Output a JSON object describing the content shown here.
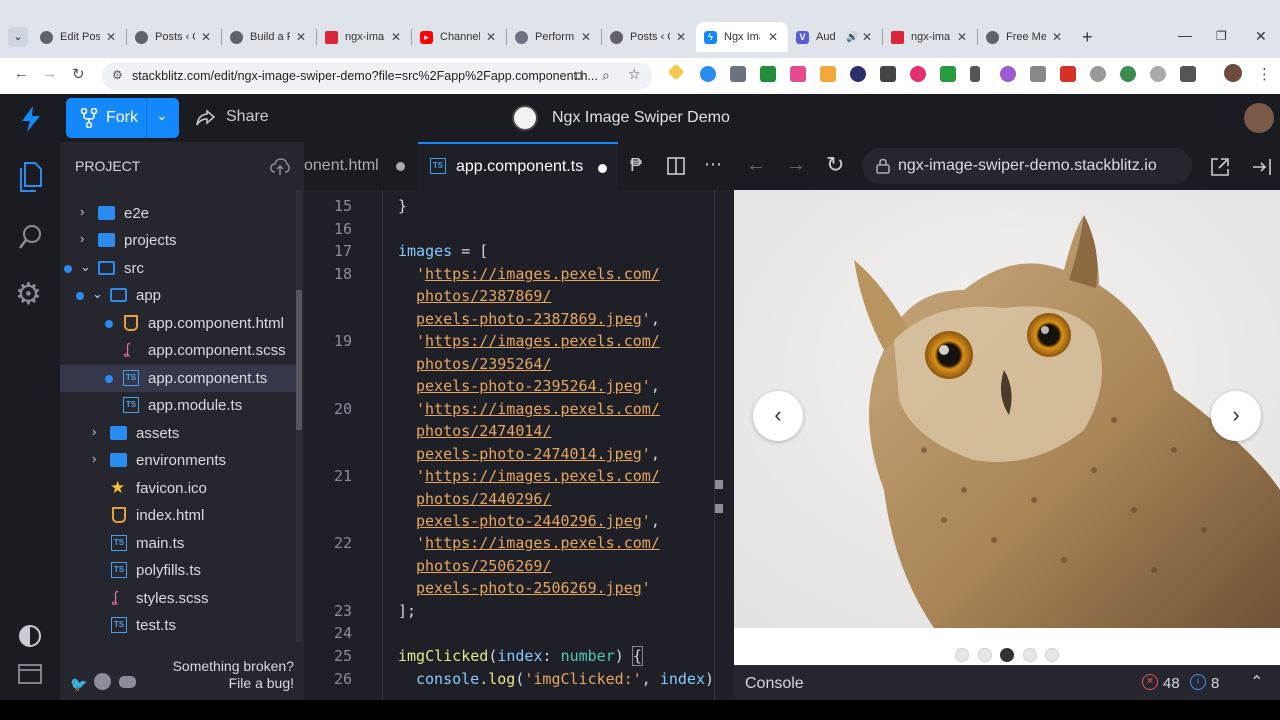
{
  "browser": {
    "tabs": [
      {
        "title": "Edit Post",
        "favicon_color": "#5f6368"
      },
      {
        "title": "Posts ‹ C",
        "favicon_color": "#5f6368"
      },
      {
        "title": "Build a F",
        "favicon_color": "#5f6368"
      },
      {
        "title": "ngx-ima",
        "favicon_color": "#d9263a"
      },
      {
        "title": "Channel",
        "favicon_color": "#ff0000"
      },
      {
        "title": "Perform",
        "favicon_color": "#6b7280"
      },
      {
        "title": "Posts ‹ C",
        "favicon_color": "#5f6368"
      },
      {
        "title": "Ngx Ima",
        "favicon_color": "#1389fd",
        "active": true
      },
      {
        "title": "Aud",
        "favicon_color": "#5b5bd6"
      },
      {
        "title": "ngx-ima",
        "favicon_color": "#d9263a"
      },
      {
        "title": "Free Me",
        "favicon_color": "#5f6368"
      }
    ],
    "url": "stackblitz.com/edit/ngx-image-swiper-demo?file=src%2Fapp%2Fapp.component.h..."
  },
  "header": {
    "fork_label": "Fork",
    "share_label": "Share",
    "project_title": "Ngx Image Swiper Demo"
  },
  "explorer": {
    "title": "PROJECT",
    "items": [
      {
        "name": "e2e",
        "type": "folder"
      },
      {
        "name": "projects",
        "type": "folder"
      },
      {
        "name": "src",
        "type": "folder-open"
      },
      {
        "name": "app",
        "type": "folder-open"
      },
      {
        "name": "app.component.html",
        "type": "html"
      },
      {
        "name": "app.component.scss",
        "type": "scss"
      },
      {
        "name": "app.component.ts",
        "type": "ts",
        "selected": true
      },
      {
        "name": "app.module.ts",
        "type": "ts"
      },
      {
        "name": "assets",
        "type": "folder"
      },
      {
        "name": "environments",
        "type": "folder"
      },
      {
        "name": "favicon.ico",
        "type": "star"
      },
      {
        "name": "index.html",
        "type": "html"
      },
      {
        "name": "main.ts",
        "type": "ts"
      },
      {
        "name": "polyfills.ts",
        "type": "ts"
      },
      {
        "name": "styles.scss",
        "type": "scss"
      },
      {
        "name": "test.ts",
        "type": "ts"
      }
    ],
    "footer_line1": "Something broken?",
    "footer_line2": "File a bug!"
  },
  "editor": {
    "tab_inactive": "onent.html",
    "tab_active": "app.component.ts",
    "line_numbers": [
      "15",
      "16",
      "17",
      "18",
      "19",
      "20",
      "21",
      "22",
      "23",
      "24",
      "25",
      "26"
    ]
  },
  "preview": {
    "url": "ngx-image-swiper-demo.stackblitz.io",
    "active_dot": 3,
    "dot_count": 5
  },
  "console": {
    "label": "Console",
    "errors": "48",
    "infos": "8"
  }
}
